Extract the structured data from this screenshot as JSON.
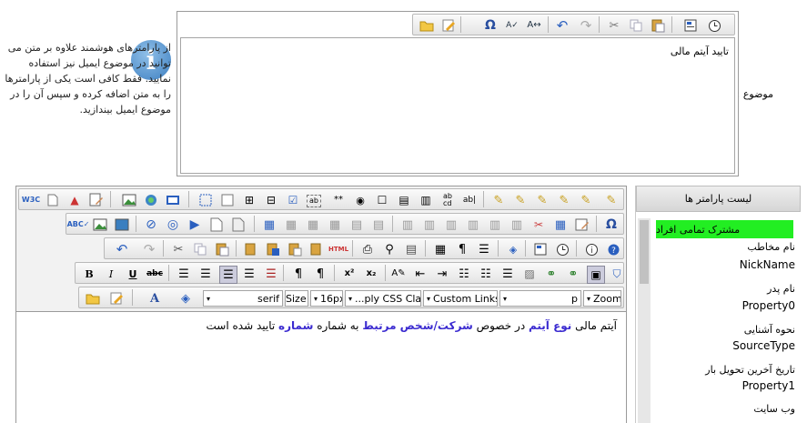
{
  "subject": {
    "label": "موضوع :",
    "text": "تایید آیتم مالی",
    "toolbar": [
      "folder-icon",
      "edit-icon",
      "omega-icon",
      "spellcheck-icon",
      "find-replace-icon",
      "undo-icon",
      "redo-icon",
      "cut-icon",
      "copy-icon",
      "paste-icon",
      "template-icon",
      "clock-icon"
    ]
  },
  "info": {
    "icon": "info-icon",
    "text": "از پارامترهای هوشمند علاوه بر متن می توانید در موضوع ایمیل نیز استفاده نمایید. فقط کافی است یکی از پارامترها را به متن اضافه کرده و سپس آن را در موضوع ایمیل بیندازید."
  },
  "params": {
    "header": "لیست پارامتر ها",
    "highlight_color": "#22ee22",
    "items": [
      {
        "label": "مشترک تمامی افراد",
        "value": ""
      },
      {
        "label": "نام مخاطب",
        "value": "NickName"
      },
      {
        "label": "نام پدر",
        "value": "Property0"
      },
      {
        "label": "نحوه آشنایی",
        "value": "SourceType"
      },
      {
        "label": "تاریخ آخرین تحویل بار",
        "value": "Property1"
      },
      {
        "label": "وب سایت",
        "value": ""
      }
    ]
  },
  "body": {
    "toolbar": {
      "font_value": "serif",
      "size_value": "Size",
      "fontsize_value": "16px",
      "css_value": "...ply CSS Class",
      "links_value": "Custom Links",
      "p_value": "p",
      "zoom_value": "Zoom"
    },
    "text": {
      "t1": "آیتم مالی",
      "p1": "نوع آیتم",
      "t2": "در خصوص",
      "p2": "شرکت/شخص مرتبط",
      "t3": "به شماره",
      "p3": "شماره",
      "t4": "تایید شده است"
    }
  }
}
